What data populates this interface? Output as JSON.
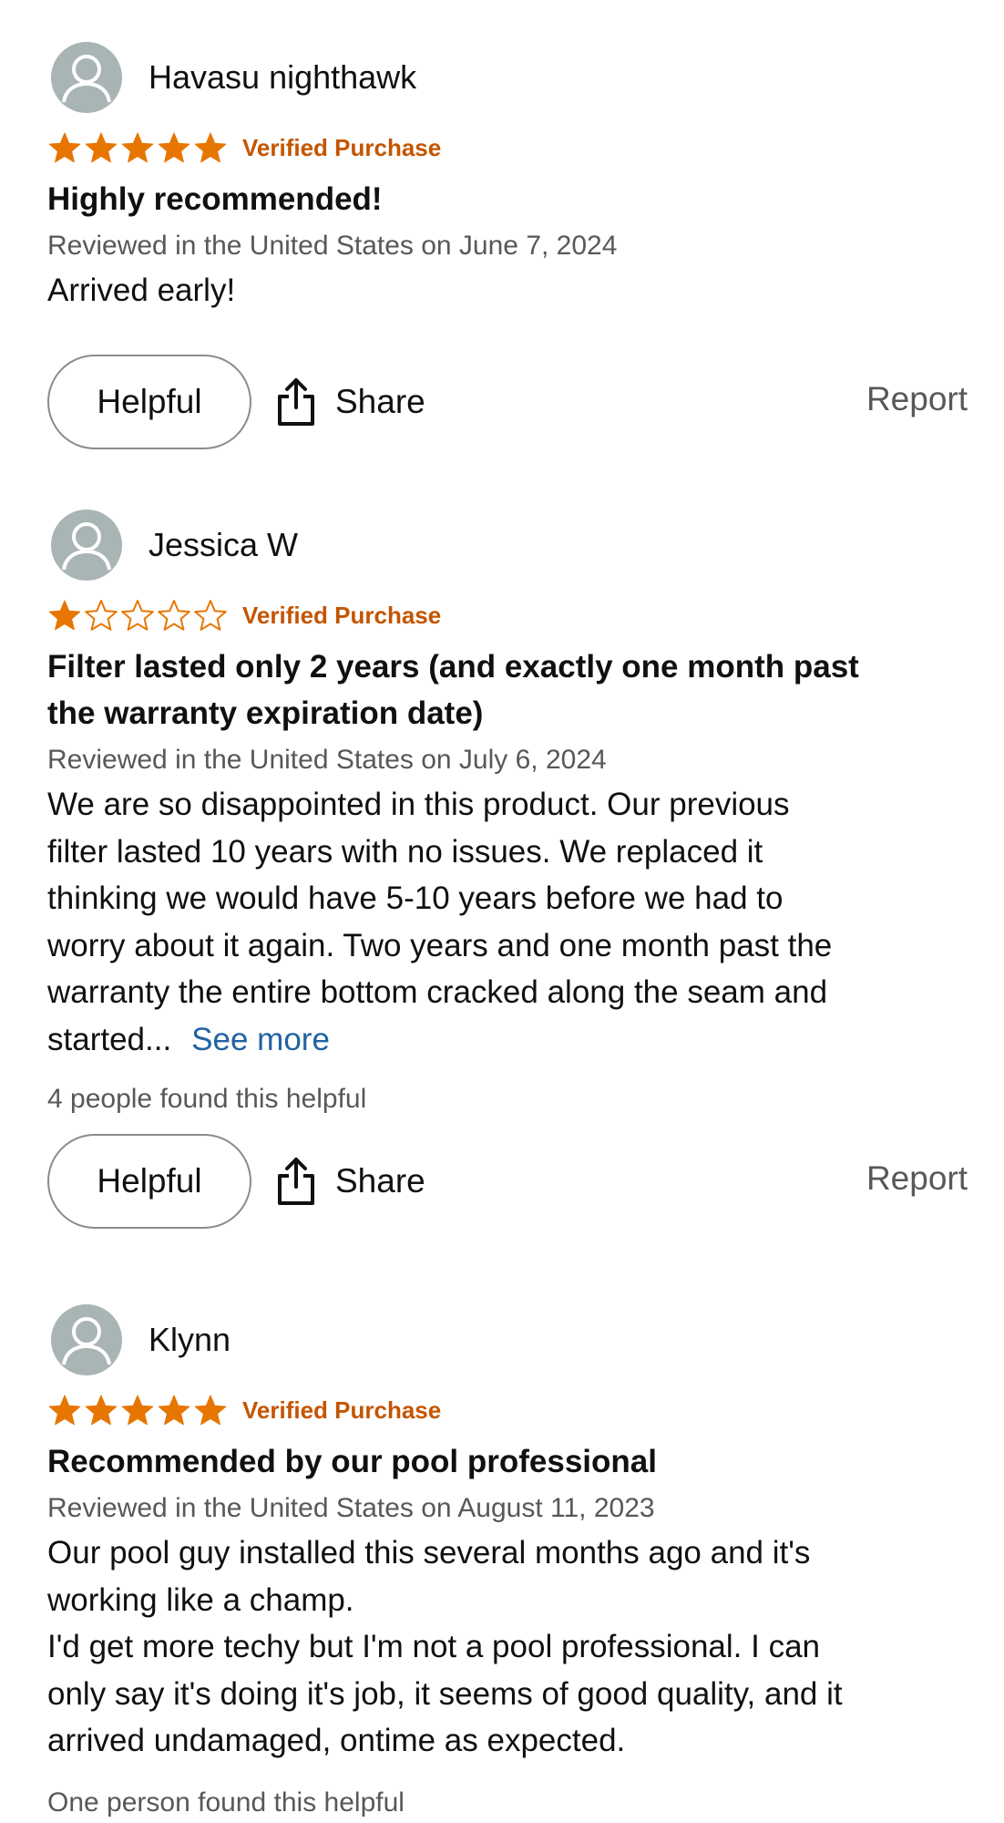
{
  "reviews": [
    {
      "reviewer": "Havasu nighthawk",
      "stars": 5,
      "verified": "Verified Purchase",
      "title": "Highly recommended!",
      "date": "Reviewed in the United States on June 7, 2024",
      "body": [
        "Arrived early!"
      ],
      "helpful_label": "Helpful",
      "share_label": "Share",
      "report_label": "Report"
    },
    {
      "reviewer": "Jessica W",
      "stars": 1,
      "verified": "Verified Purchase",
      "title_lines": [
        "Filter lasted only 2 years (and exactly one month past",
        "the warranty expiration date)"
      ],
      "date": "Reviewed in the United States on July 6, 2024",
      "body": [
        "We are so disappointed in this product. Our previous",
        "filter lasted 10 years with no issues. We replaced it",
        "thinking we would have 5-10 years before we had to",
        "worry about it again. Two years and one month past the",
        "warranty the entire bottom cracked along the seam and",
        "started..."
      ],
      "see_more": "See more",
      "helpful_count": "4 people found this helpful",
      "helpful_label": "Helpful",
      "share_label": "Share",
      "report_label": "Report"
    },
    {
      "reviewer": "Klynn",
      "stars": 5,
      "verified": "Verified Purchase",
      "title": "Recommended by our pool professional",
      "date": "Reviewed in the United States on August 11, 2023",
      "body": [
        "Our pool guy installed this several months ago and it's",
        "working like a champ.",
        "I'd get more techy but I'm not a pool professional. I can",
        "only say it's doing it's job, it seems of good quality, and it",
        "arrived undamaged, ontime as expected."
      ],
      "helpful_count": "One person found this helpful"
    }
  ],
  "colors": {
    "star_fill": "#e77600",
    "verified": "#c45500",
    "link": "#2162a1",
    "secondary_text": "#565959",
    "avatar_bg": "#a9b4b4"
  },
  "icons": {
    "avatar": "person-silhouette-icon",
    "star": "star-icon",
    "share": "share-icon"
  }
}
